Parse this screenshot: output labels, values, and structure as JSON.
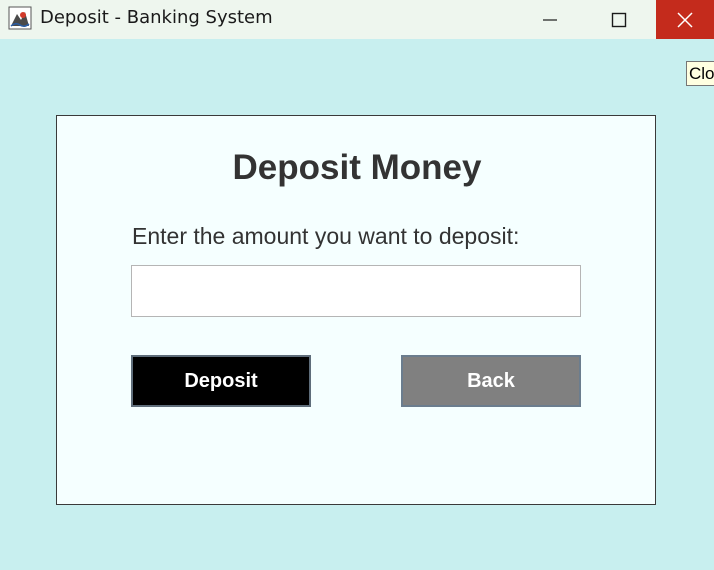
{
  "window": {
    "title": "Deposit - Banking System",
    "background_color": "#c8efef",
    "controls": {
      "minimize_icon": "minimize-icon",
      "maximize_icon": "maximize-icon",
      "close_icon": "close-icon",
      "close_color": "#c42b1c"
    },
    "tooltip": "Clo"
  },
  "panel": {
    "heading": "Deposit Money",
    "amount_label": "Enter the amount you want to deposit:",
    "amount_value": "",
    "deposit_label": "Deposit",
    "back_label": "Back",
    "deposit_color": "#000000",
    "back_color": "#808080"
  }
}
